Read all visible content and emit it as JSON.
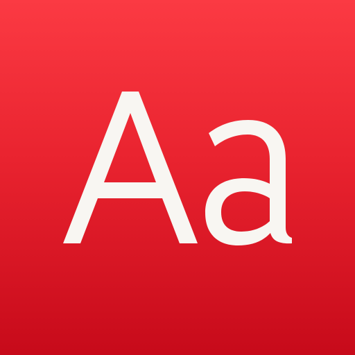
{
  "icon": {
    "glyph": "Aa",
    "background_top": "#fb3a43",
    "background_bottom": "#c70a1a",
    "glyph_color": "#f8f6f2",
    "icon_name": "font-icon"
  }
}
